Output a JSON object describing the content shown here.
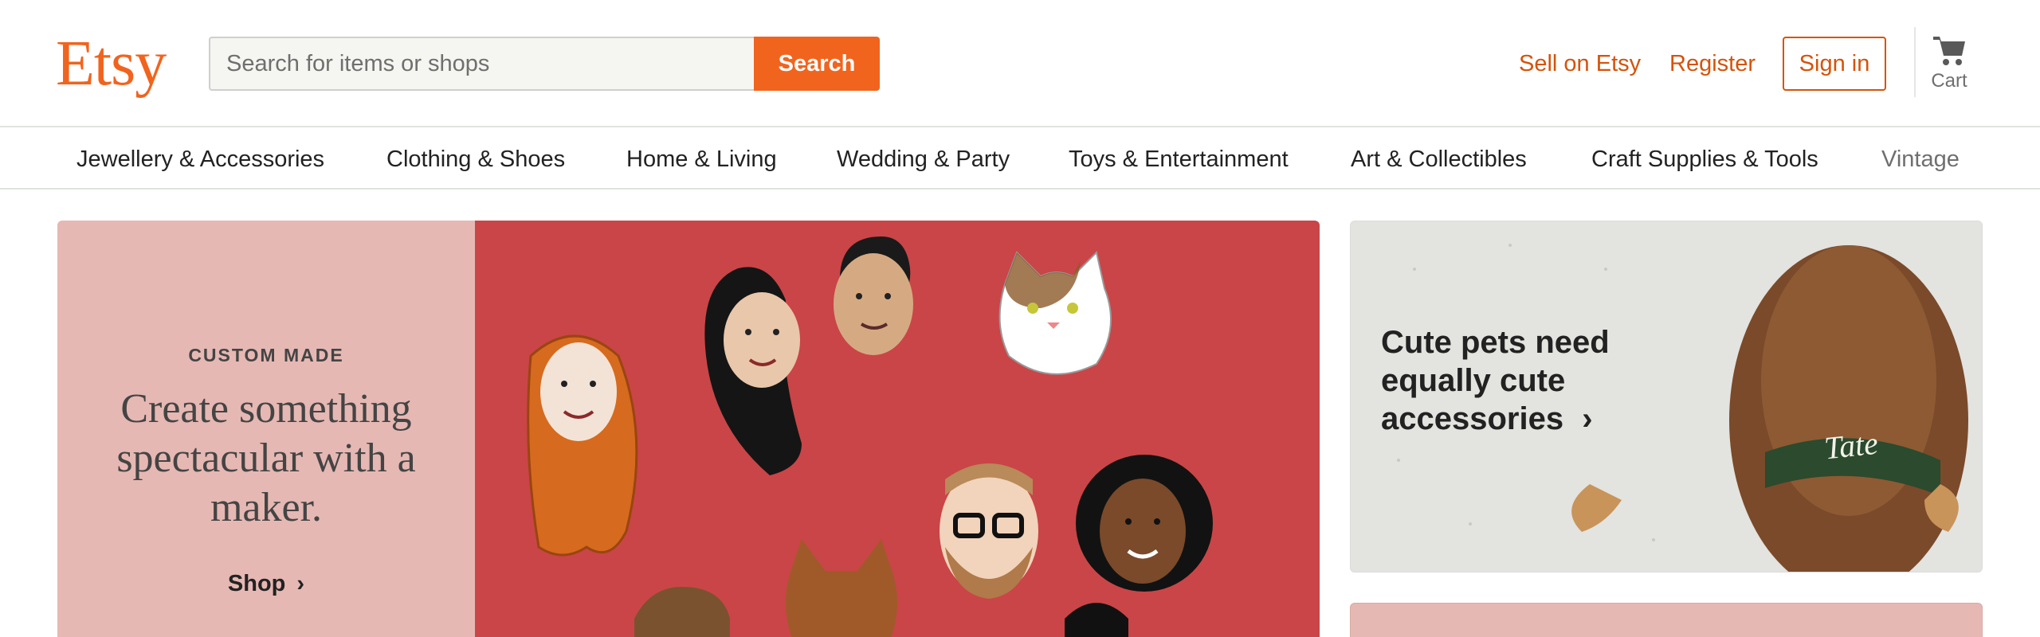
{
  "header": {
    "logo": "Etsy",
    "search": {
      "placeholder": "Search for items or shops",
      "value": "",
      "button_label": "Search"
    },
    "sell_label": "Sell on Etsy",
    "register_label": "Register",
    "signin_label": "Sign in",
    "cart_label": "Cart",
    "cart_icon": "cart-icon"
  },
  "categories": [
    "Jewellery & Accessories",
    "Clothing & Shoes",
    "Home & Living",
    "Wedding & Party",
    "Toys & Entertainment",
    "Art & Collectibles",
    "Craft Supplies & Tools",
    "Vintage"
  ],
  "hero": {
    "eyebrow": "CUSTOM MADE",
    "headline": "Create something spectacular with a maker.",
    "cta_label": "Shop",
    "cta_icon": "chevron-right-icon"
  },
  "promo": {
    "text": "Cute pets need equally cute accessories",
    "icon": "chevron-right-icon",
    "collar_text": "Tate"
  },
  "colors": {
    "brand": "#f1641e",
    "link": "#d5530a",
    "hero_left_bg": "#e6b8b3",
    "hero_right_bg": "#ca4547"
  }
}
